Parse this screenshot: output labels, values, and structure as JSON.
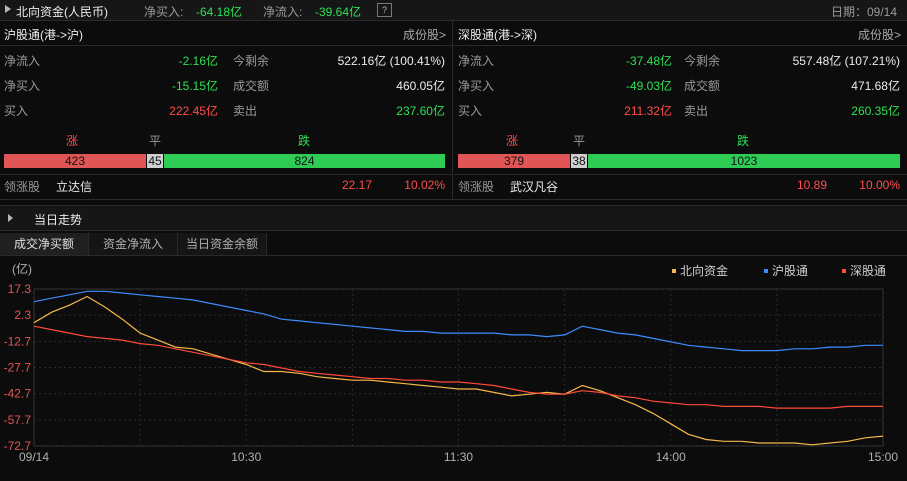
{
  "top": {
    "title": "北向资金(人民币)",
    "buy_label": "净买入:",
    "buy_value": "-64.18亿",
    "flow_label": "净流入:",
    "flow_value": "-39.64亿",
    "help_icon": "?",
    "date": "日期：09/14"
  },
  "sh": {
    "title": "沪股通(港->沪)",
    "constituents": "成份股>",
    "rows": [
      {
        "l1": "净流入",
        "v1": "-2.16亿",
        "l2": "今剩余",
        "v2": "522.16亿 (100.41%)"
      },
      {
        "l1": "净买入",
        "v1": "-15.15亿",
        "l2": "成交额",
        "v2": "460.05亿"
      },
      {
        "l1": "买入",
        "v1": "222.45亿",
        "l2": "卖出",
        "v2": "237.60亿"
      }
    ],
    "up_label": "涨",
    "flat_label": "平",
    "down_label": "跌",
    "up": "423",
    "flat": "45",
    "down": "824",
    "leader_label": "领涨股",
    "leader_name": "立达信",
    "leader_price": "22.17",
    "leader_pct": "10.02%"
  },
  "sz": {
    "title": "深股通(港->深)",
    "constituents": "成份股>",
    "rows": [
      {
        "l1": "净流入",
        "v1": "-37.48亿",
        "l2": "今剩余",
        "v2": "557.48亿 (107.21%)"
      },
      {
        "l1": "净买入",
        "v1": "-49.03亿",
        "l2": "成交额",
        "v2": "471.68亿"
      },
      {
        "l1": "买入",
        "v1": "211.32亿",
        "l2": "卖出",
        "v2": "260.35亿"
      }
    ],
    "up_label": "涨",
    "flat_label": "平",
    "down_label": "跌",
    "up": "379",
    "flat": "38",
    "down": "1023",
    "leader_label": "领涨股",
    "leader_name": "武汉凡谷",
    "leader_price": "10.89",
    "leader_pct": "10.00%"
  },
  "section": {
    "title": "当日走势"
  },
  "tabs": [
    "成交净买额",
    "资金净流入",
    "当日资金余额"
  ],
  "colors": {
    "north": "#f5b84a",
    "sh": "#3d8cff",
    "sz": "#ff4a3a",
    "up": "#e05555",
    "flat": "#cfcfcf",
    "down": "#2ecc55"
  },
  "chart_data": {
    "type": "line",
    "ylabel": "(亿)",
    "y_ticks": [
      "17.3",
      "2.3",
      "-12.7",
      "-27.7",
      "-42.7",
      "-57.7",
      "-72.7"
    ],
    "y_values": [
      17.3,
      2.3,
      -12.7,
      -27.7,
      -42.7,
      -57.7,
      -72.7
    ],
    "ylim": [
      -72.7,
      17.3
    ],
    "x_ticks": [
      "09/14",
      "10:30",
      "11:30",
      "14:00",
      "15:00"
    ],
    "x_tick_pos": [
      0,
      60,
      120,
      180,
      240
    ],
    "xlim": [
      0,
      240
    ],
    "grid": true,
    "legend_position": "top-right",
    "series": [
      {
        "name": "北向资金",
        "color": "#f5b84a",
        "x": [
          0,
          5,
          10,
          15,
          20,
          25,
          30,
          35,
          40,
          45,
          50,
          55,
          60,
          65,
          70,
          75,
          80,
          85,
          90,
          95,
          100,
          105,
          110,
          115,
          120,
          125,
          130,
          135,
          140,
          145,
          150,
          155,
          160,
          165,
          170,
          175,
          180,
          185,
          190,
          195,
          200,
          205,
          210,
          215,
          220,
          225,
          230,
          235,
          240
        ],
        "y": [
          -2,
          4,
          8,
          13,
          7,
          0,
          -8,
          -12,
          -16,
          -17,
          -20,
          -23,
          -26,
          -30,
          -30,
          -31,
          -33,
          -34,
          -35,
          -35,
          -36,
          -37,
          -38,
          -39,
          -40,
          -40,
          -42,
          -44,
          -43,
          -42,
          -43,
          -38,
          -41,
          -45,
          -49,
          -54,
          -60,
          -66,
          -69,
          -70,
          -70,
          -71,
          -71,
          -71,
          -72,
          -71,
          -70,
          -68,
          -67
        ]
      },
      {
        "name": "沪股通",
        "color": "#3d8cff",
        "x": [
          0,
          5,
          10,
          15,
          20,
          25,
          30,
          35,
          40,
          45,
          50,
          55,
          60,
          65,
          70,
          75,
          80,
          85,
          90,
          95,
          100,
          105,
          110,
          115,
          120,
          125,
          130,
          135,
          140,
          145,
          150,
          155,
          160,
          165,
          170,
          175,
          180,
          185,
          190,
          195,
          200,
          205,
          210,
          215,
          220,
          225,
          230,
          235,
          240
        ],
        "y": [
          10,
          12,
          14,
          16,
          16,
          15,
          14,
          13,
          12,
          11,
          9,
          7,
          5,
          3,
          0,
          -1,
          -2,
          -3,
          -4,
          -5,
          -6,
          -7,
          -7,
          -8,
          -8,
          -8,
          -8,
          -9,
          -9,
          -10,
          -9,
          -4,
          -6,
          -8,
          -9,
          -11,
          -13,
          -15,
          -16,
          -17,
          -18,
          -18,
          -18,
          -17,
          -17,
          -16,
          -16,
          -15,
          -15
        ]
      },
      {
        "name": "深股通",
        "color": "#ff4a3a",
        "x": [
          0,
          5,
          10,
          15,
          20,
          25,
          30,
          35,
          40,
          45,
          50,
          55,
          60,
          65,
          70,
          75,
          80,
          85,
          90,
          95,
          100,
          105,
          110,
          115,
          120,
          125,
          130,
          135,
          140,
          145,
          150,
          155,
          160,
          165,
          170,
          175,
          180,
          185,
          190,
          195,
          200,
          205,
          210,
          215,
          220,
          225,
          230,
          235,
          240
        ],
        "y": [
          -4,
          -6,
          -8,
          -10,
          -11,
          -12,
          -14,
          -15,
          -17,
          -19,
          -21,
          -23,
          -25,
          -26,
          -28,
          -30,
          -31,
          -32,
          -33,
          -34,
          -34,
          -35,
          -35,
          -36,
          -36,
          -37,
          -38,
          -40,
          -42,
          -43,
          -43,
          -41,
          -42,
          -44,
          -45,
          -47,
          -48,
          -49,
          -49,
          -50,
          -50,
          -50,
          -51,
          -51,
          -51,
          -51,
          -50,
          -50,
          -50
        ]
      }
    ]
  }
}
